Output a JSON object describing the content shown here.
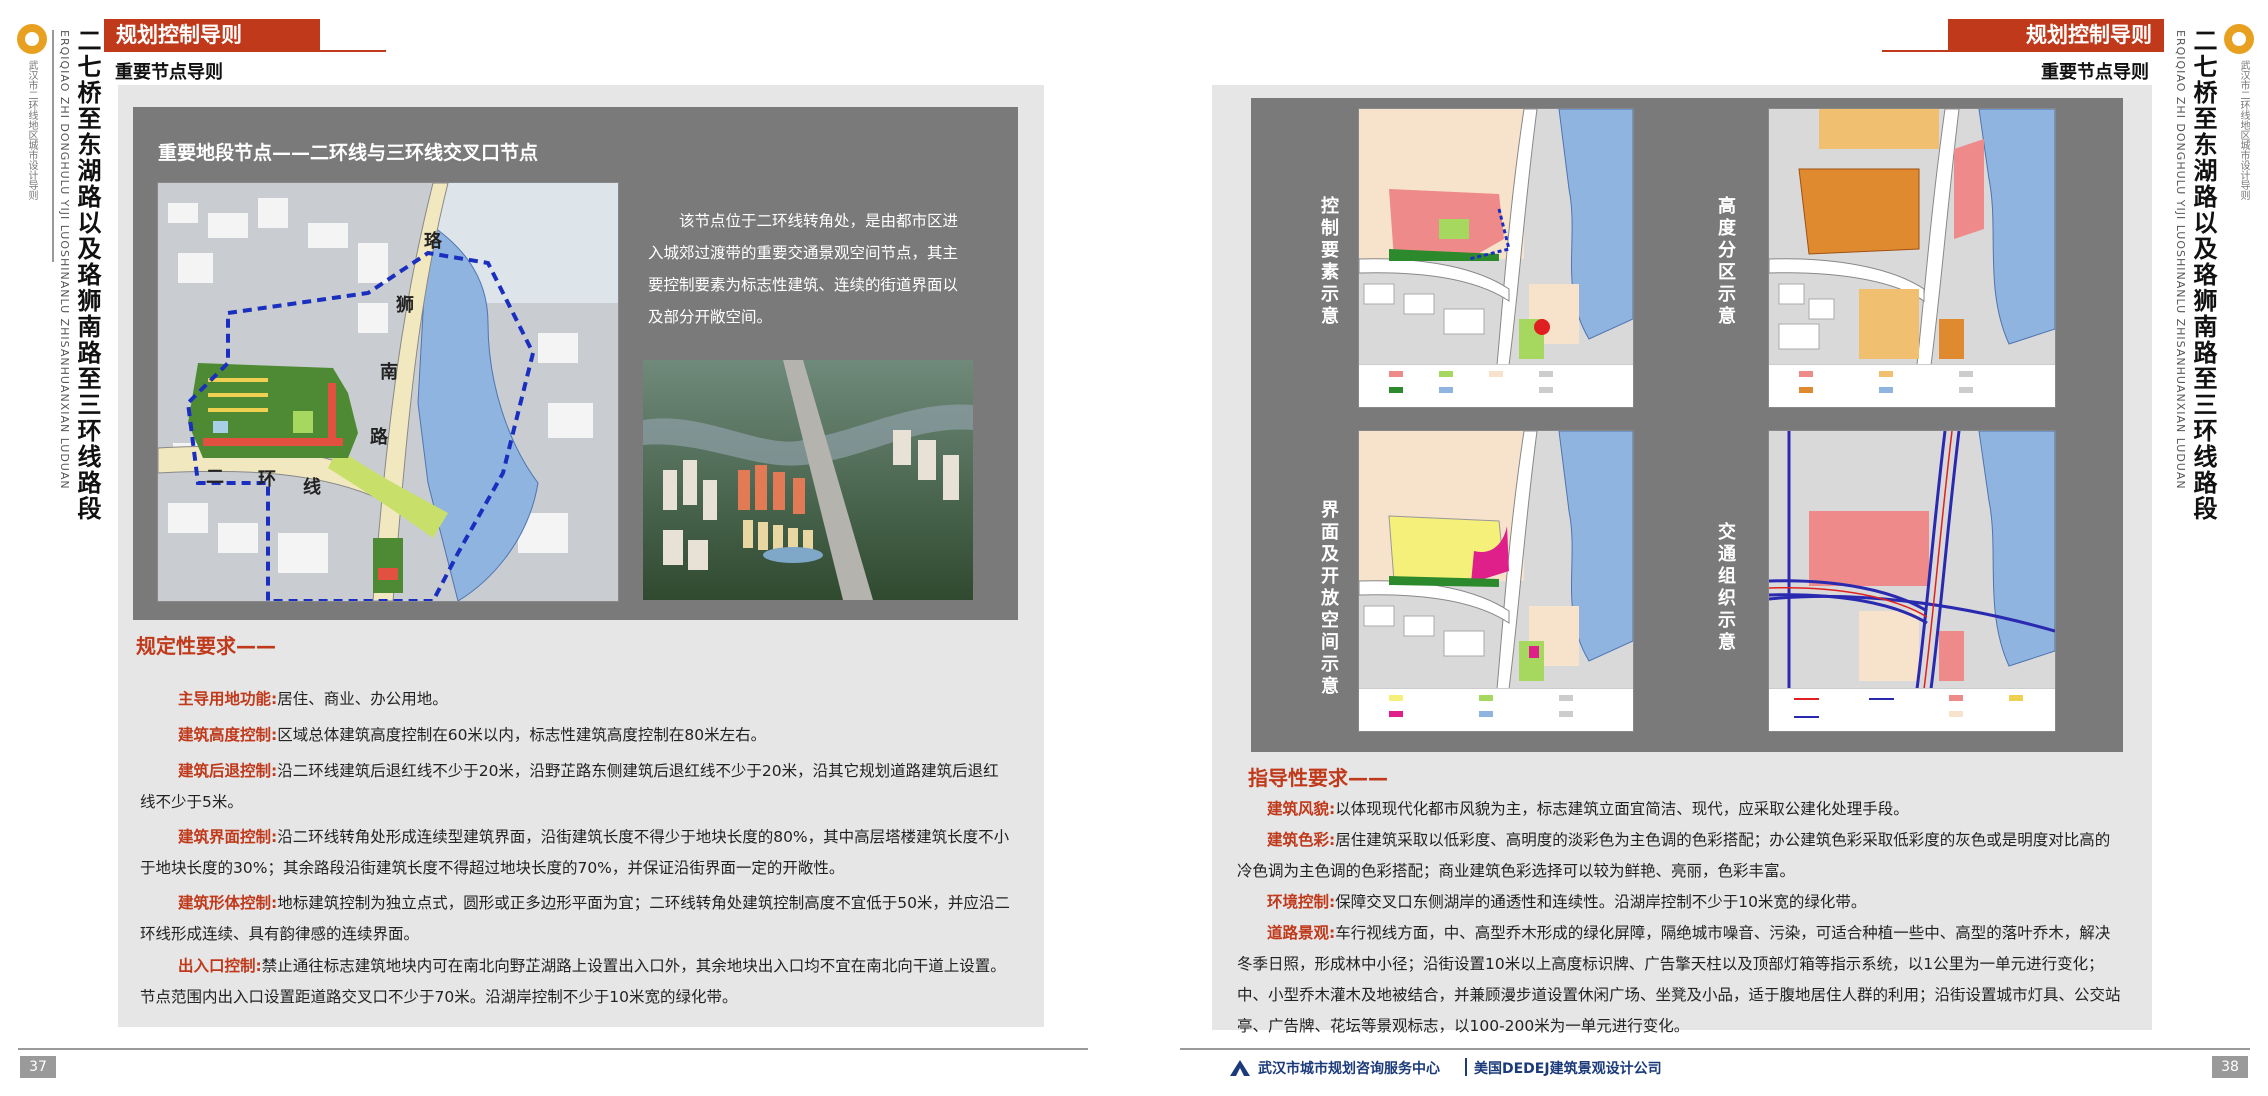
{
  "header": {
    "left_tab": "规划控制导则",
    "right_tab": "规划控制导则",
    "left_subhead": "重要节点导则",
    "right_subhead": "重要节点导则"
  },
  "side": {
    "title": "二七桥至东湖路以及珞狮南路至三环线路段",
    "pinyin": "ERQIQIAO ZHI DONGHULU YIJI LUOSHINANLU ZHISANHUANXIAN LUDUAN",
    "org": "武汉市二环线地区城市设计导则"
  },
  "left_page": {
    "node_title": "重要地段节点——二环线与三环线交叉口节点",
    "node_desc": "该节点位于二环线转角处，是由都市区进入城郊过渡带的重要交通景观空间节点，其主要控制要素为标志性建筑、连续的街道界面以及部分开敞空间。",
    "map_labels": {
      "road1": "珞",
      "road2": "狮",
      "road3": "南",
      "road4": "路",
      "ring1": "二",
      "ring2": "环",
      "ring3": "线"
    },
    "req_title": "规定性要求——",
    "requirements": [
      {
        "key": "主导用地功能:",
        "text": "居住、商业、办公用地。"
      },
      {
        "key": "建筑高度控制:",
        "text": "区域总体建筑高度控制在60米以内，标志性建筑高度控制在80米左右。"
      },
      {
        "key": "建筑后退控制:",
        "text": "沿二环线建筑后退红线不少于20米，沿野芷路东侧建筑后退红线不少于20米，沿其它规划道路建筑后退红线不少于5米。"
      },
      {
        "key": "建筑界面控制:",
        "text": "沿二环线转角处形成连续型建筑界面，沿街建筑长度不得少于地块长度的80%，其中高层塔楼建筑长度不小于地块长度的30%；其余路段沿街建筑长度不得超过地块长度的70%，并保证沿街界面一定的开敞性。"
      },
      {
        "key": "建筑形体控制:",
        "text": "地标建筑控制为独立点式，圆形或正多边形平面为宜；二环线转角处建筑控制高度不宜低于50米，并应沿二环线形成连续、具有韵律感的连续界面。"
      },
      {
        "key": "出入口控制:",
        "text": "禁止通往标志建筑地块内可在南北向野芷湖路上设置出入口外，其余地块出入口均不宜在南北向干道上设置。节点范围内出入口设置距道路交叉口不少于70米。沿湖岸控制不少于10米宽的绿化带。"
      }
    ],
    "page_number": "37"
  },
  "right_page": {
    "map_titles": [
      "控制要素示意",
      "高度分区示意",
      "界面及开放空间示意",
      "交通组织示意"
    ],
    "guide_title": "指导性要求——",
    "guides": [
      {
        "key": "建筑风貌:",
        "text": "以体现现代化都市风貌为主，标志建筑立面宜简洁、现代，应采取公建化处理手段。"
      },
      {
        "key": "建筑色彩:",
        "text": "居住建筑采取以低彩度、高明度的淡彩色为主色调的色彩搭配；办公建筑色彩采取低彩度的灰色或是明度对比高的冷色调为主色调的色彩搭配；商业建筑色彩选择可以较为鲜艳、亮丽，色彩丰富。"
      },
      {
        "key": "环境控制:",
        "text": "保障交叉口东侧湖岸的通透性和连续性。沿湖岸控制不少于10米宽的绿化带。"
      },
      {
        "key": "道路景观:",
        "text": "车行视线方面，中、高型乔木形成的绿化屏障，隔绝城市噪音、污染，可适合种植一些中、高型的落叶乔木，解决冬季日照，形成林中小径；沿街设置10米以上高度标识牌、广告擎天柱以及顶部灯箱等指示系统，以1公里为一单元进行变化；中、小型乔木灌木及地被结合，并兼顾漫步道设置休闲广场、坐凳及小品，适于腹地居住人群的利用；沿街设置城市灯具、公交站亭、广告牌、花坛等景观标志，以100-200米为一单元进行变化。"
      }
    ],
    "footer_org1": "武汉市城市规划咨询服务中心",
    "footer_org2": "美国DEDEJ建筑景观设计公司",
    "page_number": "38"
  },
  "colors": {
    "accent": "#c0391b",
    "panel_gray": "#7a7a7a",
    "lake": "#8fb4e0",
    "boundary": "#1a2fbf"
  }
}
